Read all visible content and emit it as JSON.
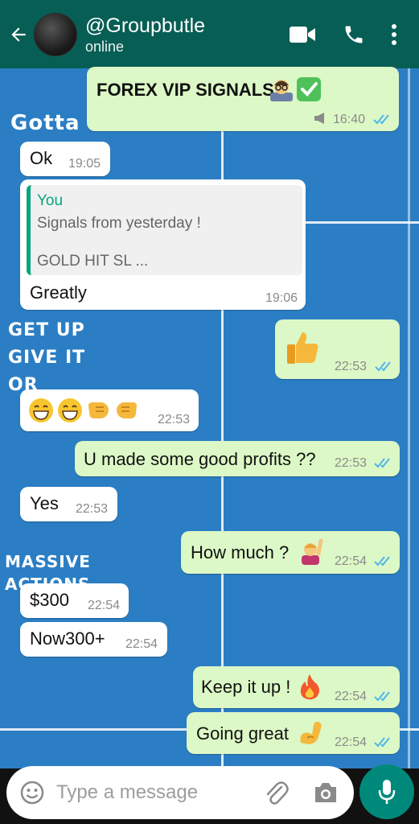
{
  "header": {
    "title": "@Groupbutle",
    "status": "online",
    "colors": {
      "bar": "#075e54",
      "accent": "#00897b"
    }
  },
  "wallpaper": {
    "texts": [
      "Gotta",
      "GET UP",
      "GIVE IT",
      "OR",
      "MASSIVE",
      "ACTIONS"
    ]
  },
  "messages": [
    {
      "dir": "out",
      "text": "FOREX VIP SIGNALS",
      "emoji": [
        "teacher",
        "check-mark"
      ],
      "time": "16:40",
      "read": true
    },
    {
      "dir": "in",
      "text": "Ok",
      "time": "19:05"
    },
    {
      "dir": "in",
      "quote_author": "You",
      "quote_line1": "Signals from yesterday !",
      "quote_line2": "GOLD HIT SL ...",
      "text": "Greatly",
      "time": "19:06"
    },
    {
      "dir": "out",
      "text": "",
      "emoji": [
        "thumbs-up"
      ],
      "time": "22:53",
      "read": true
    },
    {
      "dir": "in",
      "text": "",
      "emoji": [
        "grin",
        "grin",
        "fist-bump",
        "fist-bump"
      ],
      "time": "22:53"
    },
    {
      "dir": "out",
      "text": "U made some good profits ??",
      "time": "22:53",
      "read": true
    },
    {
      "dir": "in",
      "text": "Yes",
      "time": "22:53"
    },
    {
      "dir": "out",
      "text": "How much ?",
      "emoji": [
        "person-raising-hand"
      ],
      "time": "22:54",
      "read": true
    },
    {
      "dir": "in",
      "text": "$300",
      "time": "22:54"
    },
    {
      "dir": "in",
      "text": "Now300+",
      "time": "22:54"
    },
    {
      "dir": "out",
      "text": "Keep it up !",
      "emoji": [
        "fire"
      ],
      "time": "22:54",
      "read": true
    },
    {
      "dir": "out",
      "text": "Going great",
      "emoji": [
        "flexed-biceps"
      ],
      "time": "22:54",
      "read": true
    }
  ],
  "composer": {
    "placeholder": "Type a message",
    "icons": [
      "emoji-icon",
      "attach-icon",
      "camera-icon",
      "mic-icon"
    ]
  }
}
